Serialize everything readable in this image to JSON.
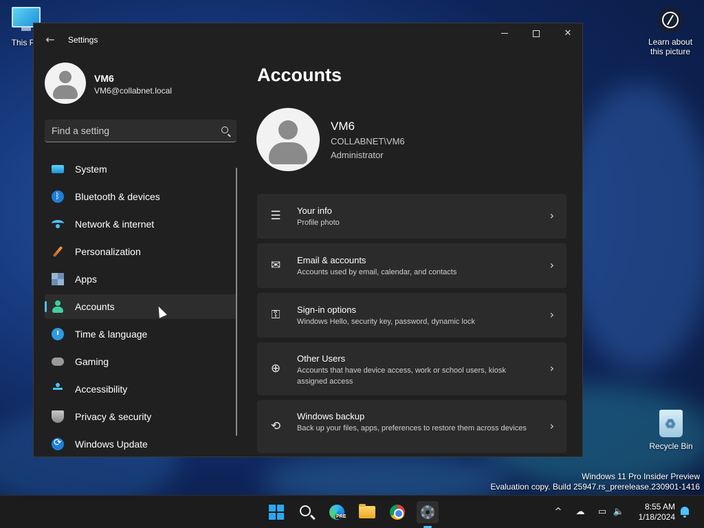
{
  "desktop": {
    "this_pc_label": "This PC",
    "learn_label": "Learn about this picture",
    "recycle_label": "Recycle Bin",
    "watermark_line1": "Windows 11 Pro Insider Preview",
    "watermark_line2": "Evaluation copy. Build 25947.rs_prerelease.230901-1416"
  },
  "window": {
    "title": "Settings",
    "back_glyph": "←",
    "close_glyph": "✕"
  },
  "sidebar": {
    "profile_name": "VM6",
    "profile_email": "VM6@collabnet.local",
    "search_placeholder": "Find a setting",
    "selected": "Accounts",
    "items": [
      {
        "label": "System",
        "icon": "system-icon"
      },
      {
        "label": "Bluetooth & devices",
        "icon": "bluetooth-icon"
      },
      {
        "label": "Network & internet",
        "icon": "wifi-icon"
      },
      {
        "label": "Personalization",
        "icon": "brush-icon"
      },
      {
        "label": "Apps",
        "icon": "apps-icon"
      },
      {
        "label": "Accounts",
        "icon": "person-icon"
      },
      {
        "label": "Time & language",
        "icon": "clock-globe-icon"
      },
      {
        "label": "Gaming",
        "icon": "gamepad-icon"
      },
      {
        "label": "Accessibility",
        "icon": "accessibility-icon"
      },
      {
        "label": "Privacy & security",
        "icon": "shield-icon"
      },
      {
        "label": "Windows Update",
        "icon": "update-icon"
      }
    ]
  },
  "main": {
    "page_title": "Accounts",
    "account_name": "VM6",
    "account_domain": "COLLABNET\\VM6",
    "account_role": "Administrator",
    "cards": [
      {
        "title": "Your info",
        "desc": "Profile photo",
        "icon": "id-card-icon",
        "glyph": "☰"
      },
      {
        "title": "Email & accounts",
        "desc": "Accounts used by email, calendar, and contacts",
        "icon": "mail-icon",
        "glyph": "✉"
      },
      {
        "title": "Sign-in options",
        "desc": "Windows Hello, security key, password, dynamic lock",
        "icon": "key-icon",
        "glyph": "⚿"
      },
      {
        "title": "Other Users",
        "desc": "Accounts that have device access, work or school users, kiosk assigned access",
        "icon": "add-person-icon",
        "glyph": "⊕"
      },
      {
        "title": "Windows backup",
        "desc": "Back up your files, apps, preferences to restore them across devices",
        "icon": "backup-icon",
        "glyph": "⟲"
      }
    ],
    "chevron": "›"
  },
  "taskbar": {
    "pre_badge": "PRE",
    "tray_chevron": "^",
    "time": "8:55 AM",
    "date": "1/18/2024"
  }
}
